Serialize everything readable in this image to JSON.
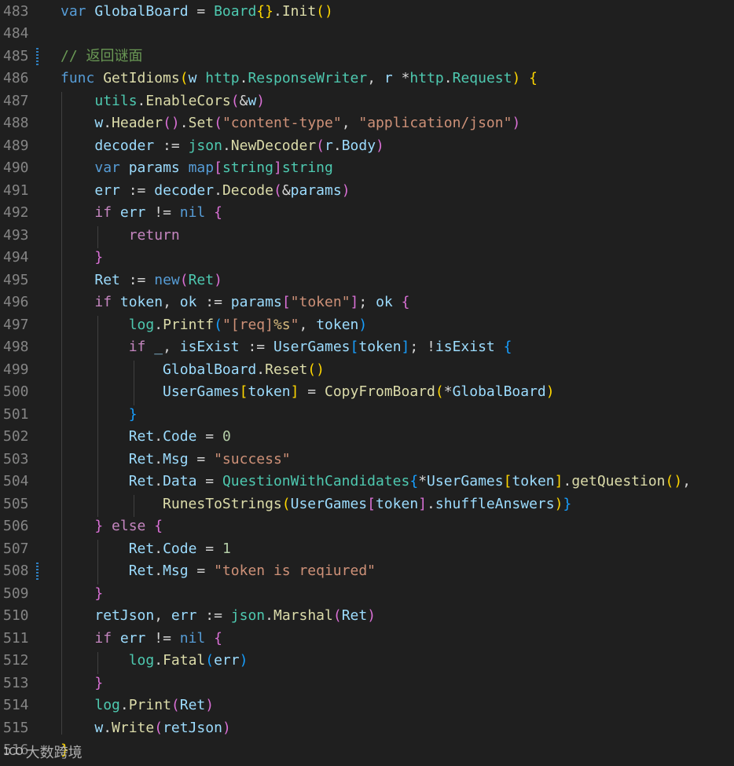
{
  "editor": {
    "lines": [
      {
        "no": "483",
        "tokens": [
          [
            "k",
            "var "
          ],
          [
            "v",
            "GlobalBoard"
          ],
          [
            "p",
            " = "
          ],
          [
            "t",
            "Board"
          ],
          [
            "b1",
            "{}"
          ],
          [
            "p",
            "."
          ],
          [
            "f",
            "Init"
          ],
          [
            "b1",
            "()"
          ]
        ]
      },
      {
        "no": "484",
        "tokens": []
      },
      {
        "no": "485",
        "mark": true,
        "tokens": [
          [
            "c",
            "// 返回谜面"
          ]
        ]
      },
      {
        "no": "486",
        "tokens": [
          [
            "k",
            "func "
          ],
          [
            "f",
            "GetIdioms"
          ],
          [
            "b1",
            "("
          ],
          [
            "v",
            "w "
          ],
          [
            "t",
            "http"
          ],
          [
            "p",
            "."
          ],
          [
            "t",
            "ResponseWriter"
          ],
          [
            "p",
            ", "
          ],
          [
            "v",
            "r "
          ],
          [
            "p",
            "*"
          ],
          [
            "t",
            "http"
          ],
          [
            "p",
            "."
          ],
          [
            "t",
            "Request"
          ],
          [
            "b1",
            ")"
          ],
          [
            "p",
            " "
          ],
          [
            "b1",
            "{"
          ]
        ]
      },
      {
        "no": "487",
        "tokens": [
          [
            "p",
            "    "
          ],
          [
            "t",
            "utils"
          ],
          [
            "p",
            "."
          ],
          [
            "f",
            "EnableCors"
          ],
          [
            "b2",
            "("
          ],
          [
            "p",
            "&"
          ],
          [
            "v",
            "w"
          ],
          [
            "b2",
            ")"
          ]
        ]
      },
      {
        "no": "488",
        "tokens": [
          [
            "p",
            "    "
          ],
          [
            "v",
            "w"
          ],
          [
            "p",
            "."
          ],
          [
            "f",
            "Header"
          ],
          [
            "b2",
            "()"
          ],
          [
            "p",
            "."
          ],
          [
            "f",
            "Set"
          ],
          [
            "b2",
            "("
          ],
          [
            "s",
            "\"content-type\""
          ],
          [
            "p",
            ", "
          ],
          [
            "s",
            "\"application/json\""
          ],
          [
            "b2",
            ")"
          ]
        ]
      },
      {
        "no": "489",
        "tokens": [
          [
            "p",
            "    "
          ],
          [
            "v",
            "decoder"
          ],
          [
            "p",
            " := "
          ],
          [
            "t",
            "json"
          ],
          [
            "p",
            "."
          ],
          [
            "f",
            "NewDecoder"
          ],
          [
            "b2",
            "("
          ],
          [
            "v",
            "r"
          ],
          [
            "p",
            "."
          ],
          [
            "v",
            "Body"
          ],
          [
            "b2",
            ")"
          ]
        ]
      },
      {
        "no": "490",
        "tokens": [
          [
            "p",
            "    "
          ],
          [
            "k",
            "var "
          ],
          [
            "v",
            "params "
          ],
          [
            "k",
            "map"
          ],
          [
            "b2",
            "["
          ],
          [
            "t",
            "string"
          ],
          [
            "b2",
            "]"
          ],
          [
            "t",
            "string"
          ]
        ]
      },
      {
        "no": "491",
        "tokens": [
          [
            "p",
            "    "
          ],
          [
            "v",
            "err"
          ],
          [
            "p",
            " := "
          ],
          [
            "v",
            "decoder"
          ],
          [
            "p",
            "."
          ],
          [
            "f",
            "Decode"
          ],
          [
            "b2",
            "("
          ],
          [
            "p",
            "&"
          ],
          [
            "v",
            "params"
          ],
          [
            "b2",
            ")"
          ]
        ]
      },
      {
        "no": "492",
        "tokens": [
          [
            "p",
            "    "
          ],
          [
            "kc",
            "if "
          ],
          [
            "v",
            "err"
          ],
          [
            "p",
            " != "
          ],
          [
            "k",
            "nil"
          ],
          [
            "p",
            " "
          ],
          [
            "b2",
            "{"
          ]
        ]
      },
      {
        "no": "493",
        "tokens": [
          [
            "p",
            "        "
          ],
          [
            "kc",
            "return"
          ]
        ]
      },
      {
        "no": "494",
        "tokens": [
          [
            "p",
            "    "
          ],
          [
            "b2",
            "}"
          ]
        ]
      },
      {
        "no": "495",
        "tokens": [
          [
            "p",
            "    "
          ],
          [
            "v",
            "Ret"
          ],
          [
            "p",
            " := "
          ],
          [
            "k",
            "new"
          ],
          [
            "b2",
            "("
          ],
          [
            "t",
            "Ret"
          ],
          [
            "b2",
            ")"
          ]
        ]
      },
      {
        "no": "496",
        "tokens": [
          [
            "p",
            "    "
          ],
          [
            "kc",
            "if "
          ],
          [
            "v",
            "token"
          ],
          [
            "p",
            ", "
          ],
          [
            "v",
            "ok"
          ],
          [
            "p",
            " := "
          ],
          [
            "v",
            "params"
          ],
          [
            "b2",
            "["
          ],
          [
            "s",
            "\"token\""
          ],
          [
            "b2",
            "]"
          ],
          [
            "p",
            "; "
          ],
          [
            "v",
            "ok"
          ],
          [
            "p",
            " "
          ],
          [
            "b2",
            "{"
          ]
        ]
      },
      {
        "no": "497",
        "tokens": [
          [
            "p",
            "        "
          ],
          [
            "t",
            "log"
          ],
          [
            "p",
            "."
          ],
          [
            "f",
            "Printf"
          ],
          [
            "b3",
            "("
          ],
          [
            "s",
            "\"[req]"
          ],
          [
            "e",
            "%s"
          ],
          [
            "s",
            "\""
          ],
          [
            "p",
            ", "
          ],
          [
            "v",
            "token"
          ],
          [
            "b3",
            ")"
          ]
        ]
      },
      {
        "no": "498",
        "tokens": [
          [
            "p",
            "        "
          ],
          [
            "kc",
            "if "
          ],
          [
            "v",
            "_"
          ],
          [
            "p",
            ", "
          ],
          [
            "v",
            "isExist"
          ],
          [
            "p",
            " := "
          ],
          [
            "v",
            "UserGames"
          ],
          [
            "b3",
            "["
          ],
          [
            "v",
            "token"
          ],
          [
            "b3",
            "]"
          ],
          [
            "p",
            "; !"
          ],
          [
            "v",
            "isExist"
          ],
          [
            "p",
            " "
          ],
          [
            "b3",
            "{"
          ]
        ]
      },
      {
        "no": "499",
        "tokens": [
          [
            "p",
            "            "
          ],
          [
            "v",
            "GlobalBoard"
          ],
          [
            "p",
            "."
          ],
          [
            "f",
            "Reset"
          ],
          [
            "b1",
            "()"
          ]
        ]
      },
      {
        "no": "500",
        "tokens": [
          [
            "p",
            "            "
          ],
          [
            "v",
            "UserGames"
          ],
          [
            "b1",
            "["
          ],
          [
            "v",
            "token"
          ],
          [
            "b1",
            "]"
          ],
          [
            "p",
            " = "
          ],
          [
            "f",
            "CopyFromBoard"
          ],
          [
            "b1",
            "("
          ],
          [
            "p",
            "*"
          ],
          [
            "v",
            "GlobalBoard"
          ],
          [
            "b1",
            ")"
          ]
        ]
      },
      {
        "no": "501",
        "tokens": [
          [
            "p",
            "        "
          ],
          [
            "b3",
            "}"
          ]
        ]
      },
      {
        "no": "502",
        "tokens": [
          [
            "p",
            "        "
          ],
          [
            "v",
            "Ret"
          ],
          [
            "p",
            "."
          ],
          [
            "v",
            "Code"
          ],
          [
            "p",
            " = "
          ],
          [
            "n",
            "0"
          ]
        ]
      },
      {
        "no": "503",
        "tokens": [
          [
            "p",
            "        "
          ],
          [
            "v",
            "Ret"
          ],
          [
            "p",
            "."
          ],
          [
            "v",
            "Msg"
          ],
          [
            "p",
            " = "
          ],
          [
            "s",
            "\"success\""
          ]
        ]
      },
      {
        "no": "504",
        "tokens": [
          [
            "p",
            "        "
          ],
          [
            "v",
            "Ret"
          ],
          [
            "p",
            "."
          ],
          [
            "v",
            "Data"
          ],
          [
            "p",
            " = "
          ],
          [
            "t",
            "QuestionWithCandidates"
          ],
          [
            "b3",
            "{"
          ],
          [
            "p",
            "*"
          ],
          [
            "v",
            "UserGames"
          ],
          [
            "b1",
            "["
          ],
          [
            "v",
            "token"
          ],
          [
            "b1",
            "]"
          ],
          [
            "p",
            "."
          ],
          [
            "f",
            "getQuestion"
          ],
          [
            "b1",
            "()"
          ],
          [
            "p",
            ","
          ]
        ]
      },
      {
        "no": "505",
        "tokens": [
          [
            "p",
            "            "
          ],
          [
            "f",
            "RunesToStrings"
          ],
          [
            "b1",
            "("
          ],
          [
            "v",
            "UserGames"
          ],
          [
            "b2",
            "["
          ],
          [
            "v",
            "token"
          ],
          [
            "b2",
            "]"
          ],
          [
            "p",
            "."
          ],
          [
            "v",
            "shuffleAnswers"
          ],
          [
            "b1",
            ")"
          ],
          [
            "b3",
            "}"
          ]
        ]
      },
      {
        "no": "506",
        "tokens": [
          [
            "p",
            "    "
          ],
          [
            "b2",
            "}"
          ],
          [
            "p",
            " "
          ],
          [
            "kc",
            "else"
          ],
          [
            "p",
            " "
          ],
          [
            "b2",
            "{"
          ]
        ]
      },
      {
        "no": "507",
        "tokens": [
          [
            "p",
            "        "
          ],
          [
            "v",
            "Ret"
          ],
          [
            "p",
            "."
          ],
          [
            "v",
            "Code"
          ],
          [
            "p",
            " = "
          ],
          [
            "n",
            "1"
          ]
        ]
      },
      {
        "no": "508",
        "mark": true,
        "tokens": [
          [
            "p",
            "        "
          ],
          [
            "v",
            "Ret"
          ],
          [
            "p",
            "."
          ],
          [
            "v",
            "Msg"
          ],
          [
            "p",
            " = "
          ],
          [
            "s",
            "\"token is reqiured\""
          ]
        ]
      },
      {
        "no": "509",
        "tokens": [
          [
            "p",
            "    "
          ],
          [
            "b2",
            "}"
          ]
        ]
      },
      {
        "no": "510",
        "tokens": [
          [
            "p",
            "    "
          ],
          [
            "v",
            "retJson"
          ],
          [
            "p",
            ", "
          ],
          [
            "v",
            "err"
          ],
          [
            "p",
            " := "
          ],
          [
            "t",
            "json"
          ],
          [
            "p",
            "."
          ],
          [
            "f",
            "Marshal"
          ],
          [
            "b2",
            "("
          ],
          [
            "v",
            "Ret"
          ],
          [
            "b2",
            ")"
          ]
        ]
      },
      {
        "no": "511",
        "tokens": [
          [
            "p",
            "    "
          ],
          [
            "kc",
            "if "
          ],
          [
            "v",
            "err"
          ],
          [
            "p",
            " != "
          ],
          [
            "k",
            "nil"
          ],
          [
            "p",
            " "
          ],
          [
            "b2",
            "{"
          ]
        ]
      },
      {
        "no": "512",
        "tokens": [
          [
            "p",
            "        "
          ],
          [
            "t",
            "log"
          ],
          [
            "p",
            "."
          ],
          [
            "f",
            "Fatal"
          ],
          [
            "b3",
            "("
          ],
          [
            "v",
            "err"
          ],
          [
            "b3",
            ")"
          ]
        ]
      },
      {
        "no": "513",
        "tokens": [
          [
            "p",
            "    "
          ],
          [
            "b2",
            "}"
          ]
        ]
      },
      {
        "no": "514",
        "tokens": [
          [
            "p",
            "    "
          ],
          [
            "t",
            "log"
          ],
          [
            "p",
            "."
          ],
          [
            "f",
            "Print"
          ],
          [
            "b2",
            "("
          ],
          [
            "v",
            "Ret"
          ],
          [
            "b2",
            ")"
          ]
        ]
      },
      {
        "no": "515",
        "tokens": [
          [
            "p",
            "    "
          ],
          [
            "v",
            "w"
          ],
          [
            "p",
            "."
          ],
          [
            "f",
            "Write"
          ],
          [
            "b2",
            "("
          ],
          [
            "v",
            "retJson"
          ],
          [
            "b2",
            ")"
          ]
        ]
      },
      {
        "no": "516",
        "tokens": [
          [
            "b1",
            "}"
          ]
        ]
      }
    ]
  },
  "watermark": {
    "logo": "1CO",
    "text": "大数跨境"
  }
}
